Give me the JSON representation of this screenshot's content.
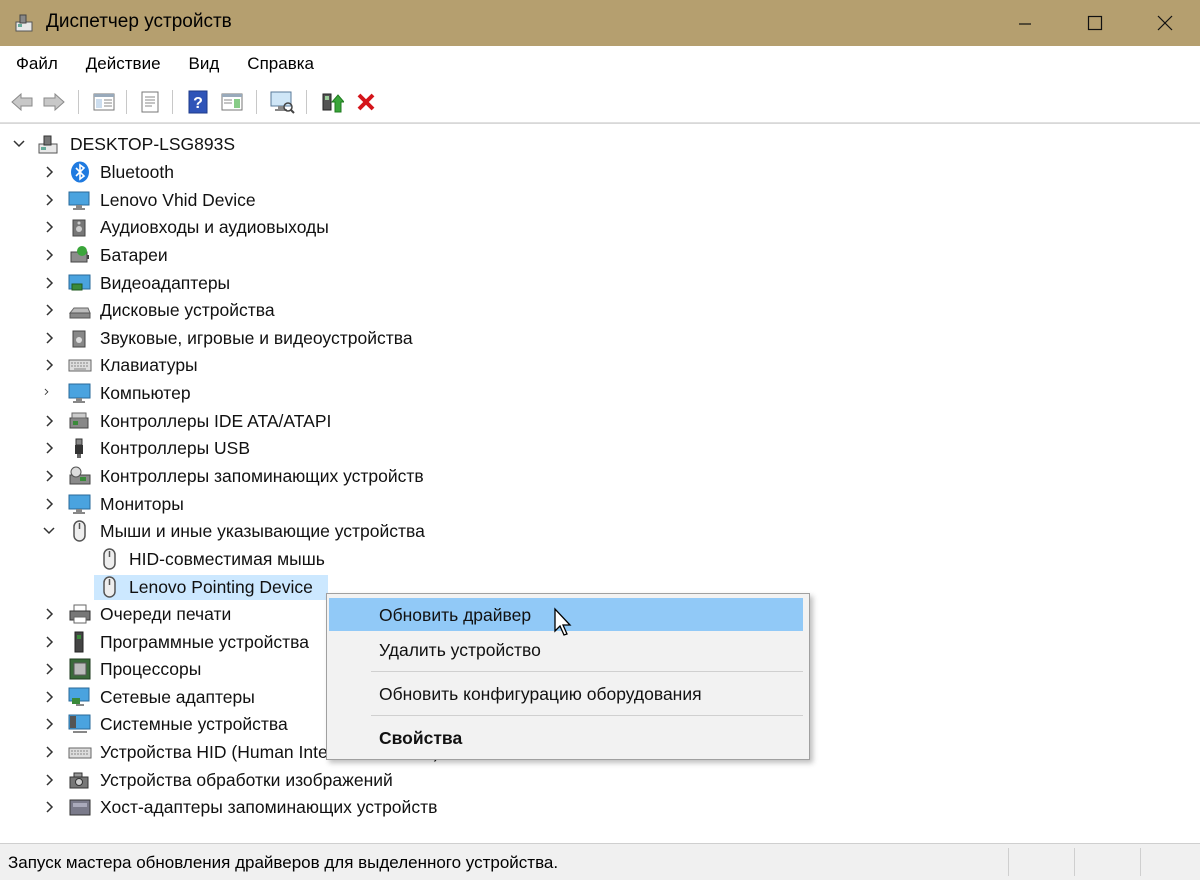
{
  "window": {
    "title": "Диспетчер устройств",
    "title_bar_color": "#b59f6f"
  },
  "menu": [
    {
      "label": "Файл"
    },
    {
      "label": "Действие"
    },
    {
      "label": "Вид"
    },
    {
      "label": "Справка"
    }
  ],
  "toolbar": {
    "icons": [
      "back-arrow-icon",
      "forward-arrow-icon",
      "show-hide-tree-icon",
      "properties-icon",
      "help-icon",
      "action-pane-icon",
      "scan-hardware-icon",
      "update-driver-icon",
      "uninstall-device-icon"
    ]
  },
  "tree": {
    "root": "DESKTOP-LSG893S",
    "categories": [
      {
        "label": "Bluetooth",
        "icon": "bluetooth-icon"
      },
      {
        "label": "Lenovo Vhid Device",
        "icon": "monitor-device-icon"
      },
      {
        "label": "Аудиовходы и аудиовыходы",
        "icon": "speaker-icon"
      },
      {
        "label": "Батареи",
        "icon": "battery-icon"
      },
      {
        "label": "Видеоадаптеры",
        "icon": "display-adapter-icon"
      },
      {
        "label": "Дисковые устройства",
        "icon": "disk-drive-icon"
      },
      {
        "label": "Звуковые, игровые и видеоустройства",
        "icon": "sound-icon"
      },
      {
        "label": "Клавиатуры",
        "icon": "keyboard-icon"
      },
      {
        "label": "Компьютер",
        "icon": "computer-icon"
      },
      {
        "label": "Контроллеры IDE ATA/ATAPI",
        "icon": "ide-controller-icon"
      },
      {
        "label": "Контроллеры USB",
        "icon": "usb-icon"
      },
      {
        "label": "Контроллеры запоминающих устройств",
        "icon": "storage-controller-icon"
      },
      {
        "label": "Мониторы",
        "icon": "monitor-icon"
      },
      {
        "label": "Мыши и иные указывающие устройства",
        "icon": "mouse-icon",
        "expanded": true,
        "children": [
          {
            "label": "HID-совместимая мышь",
            "icon": "mouse-icon"
          },
          {
            "label": "Lenovo Pointing Device",
            "icon": "mouse-icon",
            "selected": true
          }
        ]
      },
      {
        "label": "Очереди печати",
        "icon": "printer-icon"
      },
      {
        "label": "Программные устройства",
        "icon": "software-device-icon"
      },
      {
        "label": "Процессоры",
        "icon": "processor-icon"
      },
      {
        "label": "Сетевые адаптеры",
        "icon": "network-adapter-icon"
      },
      {
        "label": "Системные устройства",
        "icon": "system-device-icon"
      },
      {
        "label": "Устройства HID (Human Interface Devices)",
        "icon": "hid-icon"
      },
      {
        "label": "Устройства обработки изображений",
        "icon": "camera-icon"
      },
      {
        "label": "Хост-адаптеры запоминающих устройств",
        "icon": "storage-host-icon"
      }
    ]
  },
  "context_menu": {
    "items": [
      {
        "label": "Обновить драйвер",
        "highlighted": true
      },
      {
        "label": "Удалить устройство"
      },
      {
        "label": "Обновить конфигурацию оборудования"
      },
      {
        "label": "Свойства",
        "bold": true
      }
    ]
  },
  "statusbar": {
    "text": "Запуск мастера обновления драйверов для выделенного устройства."
  }
}
